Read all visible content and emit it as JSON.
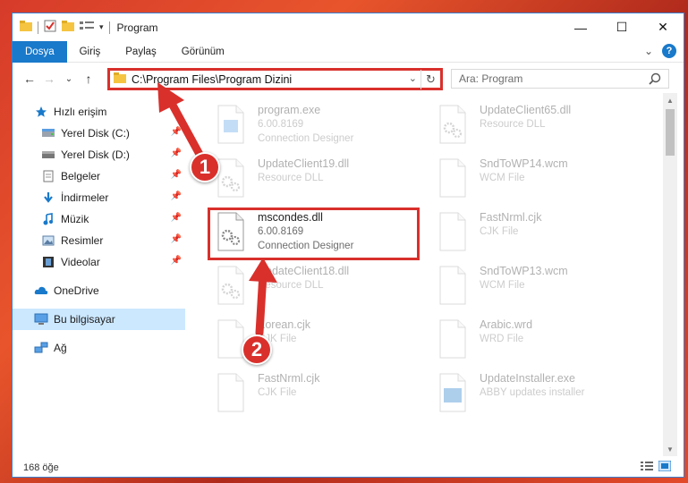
{
  "window": {
    "title": "Program",
    "controls": {
      "minimize": "—",
      "maximize": "☐",
      "close": "✕"
    }
  },
  "ribbon": {
    "tabs": [
      {
        "label": "Dosya",
        "active": true
      },
      {
        "label": "Giriş",
        "active": false
      },
      {
        "label": "Paylaş",
        "active": false
      },
      {
        "label": "Görünüm",
        "active": false
      }
    ],
    "expand": "⌄",
    "help": "?"
  },
  "nav": {
    "back": "←",
    "forward": "→",
    "recent": "⌄",
    "up": "↑",
    "address": "C:\\Program Files\\Program Dizini",
    "address_dropdown": "⌄",
    "refresh": "↻",
    "search_placeholder": "Ara: Program"
  },
  "sidebar": {
    "items": [
      {
        "label": "Hızlı erişim",
        "icon": "star-icon",
        "pinned": false
      },
      {
        "label": "Yerel Disk (C:)",
        "icon": "drive-icon",
        "pinned": true
      },
      {
        "label": "Yerel Disk (D:)",
        "icon": "drive-icon",
        "pinned": true
      },
      {
        "label": "Belgeler",
        "icon": "documents-icon",
        "pinned": true
      },
      {
        "label": "İndirmeler",
        "icon": "download-icon",
        "pinned": true
      },
      {
        "label": "Müzik",
        "icon": "music-icon",
        "pinned": true
      },
      {
        "label": "Resimler",
        "icon": "pictures-icon",
        "pinned": true
      },
      {
        "label": "Videolar",
        "icon": "video-icon",
        "pinned": true
      },
      {
        "label": "OneDrive",
        "icon": "cloud-icon",
        "pinned": false
      },
      {
        "label": "Bu bilgisayar",
        "icon": "computer-icon",
        "pinned": false,
        "selected": true
      },
      {
        "label": "Ağ",
        "icon": "network-icon",
        "pinned": false
      }
    ]
  },
  "files": [
    {
      "name": "program.exe",
      "line1": "6.00.8169",
      "line2": "Connection Designer",
      "icon": "exe-icon",
      "faded": true
    },
    {
      "name": "UpdateClient65.dll",
      "line1": "Resource DLL",
      "line2": "",
      "icon": "dll-icon",
      "faded": true
    },
    {
      "name": "UpdateClient19.dll",
      "line1": "Resource DLL",
      "line2": "",
      "icon": "dll-icon",
      "faded": true
    },
    {
      "name": "SndToWP14.wcm",
      "line1": "WCM File",
      "line2": "",
      "icon": "file-icon",
      "faded": true
    },
    {
      "name": "mscondes.dll",
      "line1": "6.00.8169",
      "line2": "Connection Designer",
      "icon": "dll-gear-icon",
      "faded": false
    },
    {
      "name": "FastNrml.cjk",
      "line1": "CJK File",
      "line2": "",
      "icon": "file-icon",
      "faded": true
    },
    {
      "name": "UpdateClient18.dll",
      "line1": "Resource DLL",
      "line2": "",
      "icon": "dll-icon",
      "faded": true
    },
    {
      "name": "SndToWP13.wcm",
      "line1": "WCM File",
      "line2": "",
      "icon": "file-icon",
      "faded": true
    },
    {
      "name": "Korean.cjk",
      "line1": "CJK File",
      "line2": "",
      "icon": "file-icon",
      "faded": true
    },
    {
      "name": "Arabic.wrd",
      "line1": "WRD File",
      "line2": "",
      "icon": "file-icon",
      "faded": true
    },
    {
      "name": "FastNrml.cjk",
      "line1": "CJK File",
      "line2": "",
      "icon": "file-icon",
      "faded": true
    },
    {
      "name": "UpdateInstaller.exe",
      "line1": "ABBY updates installer",
      "line2": "",
      "icon": "installer-icon",
      "faded": true
    }
  ],
  "status": {
    "count": "168 öğe"
  },
  "callouts": {
    "first": "1",
    "second": "2"
  },
  "colors": {
    "accent": "#1979ca",
    "highlight": "#d9302c",
    "selected": "#cce8ff"
  }
}
